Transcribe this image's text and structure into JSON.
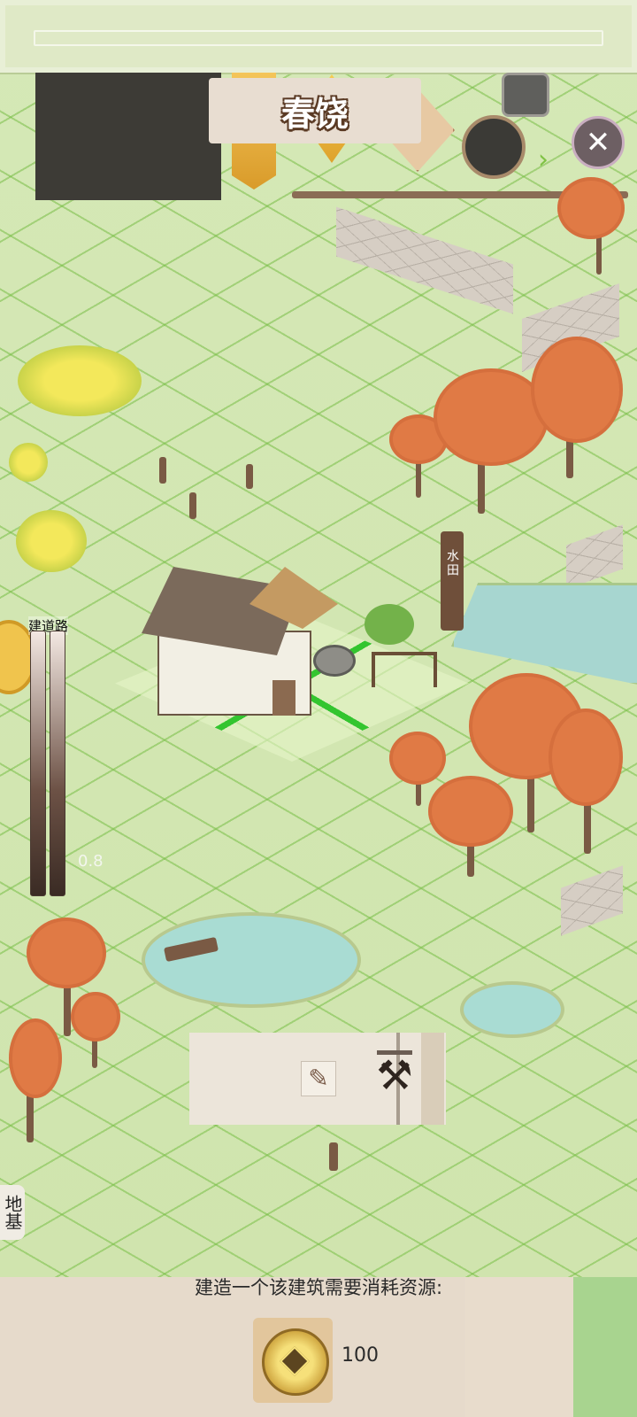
{
  "header": {
    "title": "春饶"
  },
  "map": {
    "field_sign": "水田"
  },
  "left_panel": {
    "build_label": "建道路",
    "bar_value": "0.8",
    "foundation_tab": "地基"
  },
  "action_panel": {
    "tools": [
      "brush-icon",
      "hammer-icon"
    ]
  },
  "cost_panel": {
    "prompt": "建造一个该建筑需要消耗资源:",
    "resources": [
      {
        "icon": "copper-coin-icon",
        "amount": "100"
      }
    ]
  },
  "colors": {
    "grid_line": "#7fbf4a",
    "selected_tile": "#33c52f",
    "maple_orange": "#e07a45",
    "panel_beige": "#e6dacb"
  }
}
